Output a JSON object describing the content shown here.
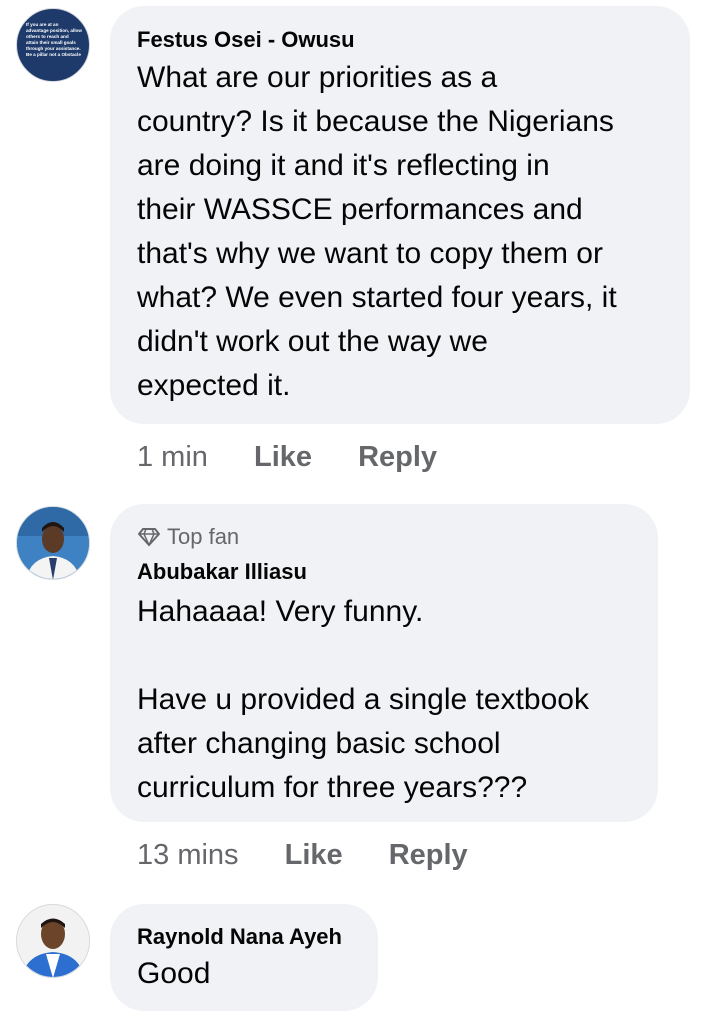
{
  "comments": [
    {
      "author": "Festus Osei - Owusu",
      "text": "What are our priorities as a\ncountry? Is it because the Nigerians\nare doing it and it's reflecting in\ntheir WASSCE performances and\nthat's why we want to copy them or\nwhat? We even started four years, it\ndidn't work out the way we\nexpected it.",
      "time": "1 min",
      "like": "Like",
      "reply": "Reply",
      "avatar_colors": {
        "bg": "#1e3a6b",
        "text": "#ffffff"
      },
      "avatar_text": "If you are at an advantage position, allow others to reach and attain their small goals through your assistance. Be a pillar not a Obstacle"
    },
    {
      "badge": "Top fan",
      "author": "Abubakar Illiasu",
      "text": "Hahaaaa! Very funny.\n\nHave u provided a single textbook\nafter changing basic school\ncurriculum for three years???",
      "time": "13 mins",
      "like": "Like",
      "reply": "Reply",
      "avatar_icon": "person-in-suit-photo"
    },
    {
      "author": "Raynold Nana Ayeh",
      "text": "Good",
      "avatar_icon": "person-in-blue-suit-photo"
    }
  ],
  "colors": {
    "bubble": "#f0f2f5",
    "meta_text": "#65676b",
    "author_text": "#050505"
  }
}
